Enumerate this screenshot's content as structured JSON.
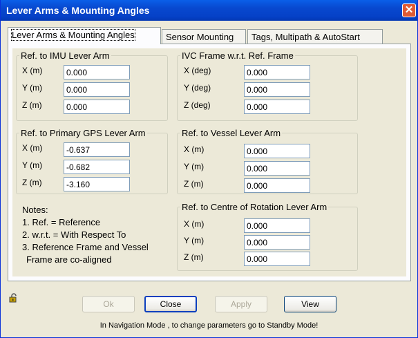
{
  "window": {
    "title": "Lever Arms & Mounting Angles",
    "close_glyph": "✕"
  },
  "tabs": [
    {
      "label": "Lever Arms & Mounting Angles",
      "active": true
    },
    {
      "label": "Sensor Mounting",
      "active": false
    },
    {
      "label": "Tags, Multipath & AutoStart",
      "active": false
    }
  ],
  "imu": {
    "legend": "Ref. to IMU Lever Arm",
    "rows": [
      {
        "label": "X (m)",
        "value": "0.000"
      },
      {
        "label": "Y (m)",
        "value": "0.000"
      },
      {
        "label": "Z (m)",
        "value": "0.000"
      }
    ]
  },
  "ivc": {
    "legend": "IVC Frame w.r.t. Ref. Frame",
    "rows": [
      {
        "label": "X (deg)",
        "value": "0.000"
      },
      {
        "label": "Y (deg)",
        "value": "0.000"
      },
      {
        "label": "Z (deg)",
        "value": "0.000"
      }
    ]
  },
  "gps": {
    "legend": "Ref. to Primary GPS Lever Arm",
    "rows": [
      {
        "label": "X (m)",
        "value": "-0.637"
      },
      {
        "label": "Y (m)",
        "value": "-0.682"
      },
      {
        "label": "Z (m)",
        "value": "-3.160"
      }
    ]
  },
  "vessel": {
    "legend": "Ref. to Vessel Lever Arm",
    "rows": [
      {
        "label": "X (m)",
        "value": "0.000"
      },
      {
        "label": "Y (m)",
        "value": "0.000"
      },
      {
        "label": "Z (m)",
        "value": "0.000"
      }
    ]
  },
  "rotation": {
    "legend": "Ref. to Centre of Rotation Lever Arm",
    "rows": [
      {
        "label": "X (m)",
        "value": "0.000"
      },
      {
        "label": "Y (m)",
        "value": "0.000"
      },
      {
        "label": "Z (m)",
        "value": "0.000"
      }
    ]
  },
  "notes": {
    "title": "Notes:",
    "lines": [
      "1. Ref. = Reference",
      "2. w.r.t. = With Respect To",
      "3. Reference Frame and Vessel",
      "Frame are co-aligned"
    ]
  },
  "buttons": {
    "ok": "Ok",
    "close": "Close",
    "apply": "Apply",
    "view": "View"
  },
  "status": "In Navigation Mode , to change parameters go to Standby Mode!",
  "icons": {
    "lock": "lock-icon"
  }
}
